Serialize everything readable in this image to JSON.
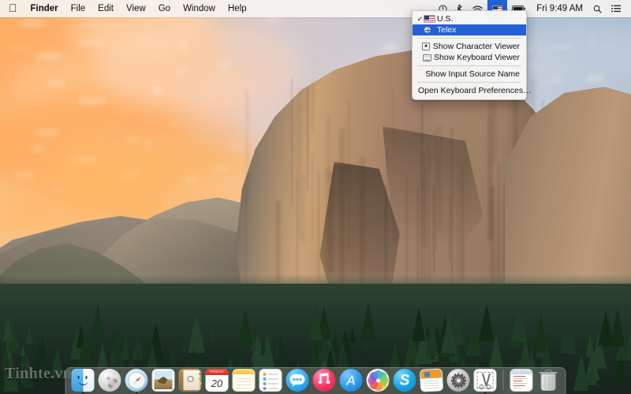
{
  "menubar": {
    "apple_icon": "apple-logo",
    "left_items": [
      {
        "label": "Finder",
        "bold": true
      },
      {
        "label": "File",
        "bold": false
      },
      {
        "label": "Edit",
        "bold": false
      },
      {
        "label": "View",
        "bold": false
      },
      {
        "label": "Go",
        "bold": false
      },
      {
        "label": "Window",
        "bold": false
      },
      {
        "label": "Help",
        "bold": false
      }
    ],
    "status_icons": [
      {
        "name": "control-center-icon",
        "glyph": "ⓘ"
      },
      {
        "name": "bluetooth-icon",
        "glyph": "ᛗ"
      },
      {
        "name": "wifi-icon",
        "glyph": "wifi"
      },
      {
        "name": "input-source-flag-icon",
        "glyph": "us-flag",
        "selected": true
      },
      {
        "name": "battery-icon",
        "glyph": "battery"
      }
    ],
    "clock": "Fri 9:49 AM",
    "search_icon": "search-icon",
    "notification_center_icon": "notification-center-icon"
  },
  "input_menu": {
    "items": [
      {
        "type": "source",
        "label": "U.S.",
        "icon": "us-flag-icon",
        "checked": true,
        "highlighted": false
      },
      {
        "type": "source",
        "label": "Telex",
        "icon": "telex-globe-icon",
        "checked": false,
        "highlighted": true
      },
      {
        "type": "separator"
      },
      {
        "type": "action",
        "label": "Show Character Viewer",
        "icon": "character-viewer-icon"
      },
      {
        "type": "action",
        "label": "Show Keyboard Viewer",
        "icon": "keyboard-viewer-icon"
      },
      {
        "type": "separator"
      },
      {
        "type": "action",
        "label": "Show Input Source Name",
        "icon": ""
      },
      {
        "type": "separator"
      },
      {
        "type": "action",
        "label": "Open Keyboard Preferences…",
        "icon": ""
      }
    ],
    "highlight_color": "#2560d6"
  },
  "dock": {
    "items": [
      {
        "name": "finder",
        "label": "Finder",
        "running": true
      },
      {
        "name": "launchpad",
        "label": "Launchpad",
        "running": false
      },
      {
        "name": "safari",
        "label": "Safari",
        "running": true
      },
      {
        "name": "photos-classic",
        "label": "iPhoto",
        "running": false
      },
      {
        "name": "contacts",
        "label": "Contacts",
        "running": false
      },
      {
        "name": "calendar",
        "label": "Calendar",
        "running": false,
        "day": "20",
        "month": "FRIDAY"
      },
      {
        "name": "notes",
        "label": "Notes",
        "running": false
      },
      {
        "name": "reminders",
        "label": "Reminders",
        "running": false
      },
      {
        "name": "messages",
        "label": "Messages",
        "running": false
      },
      {
        "name": "itunes",
        "label": "iTunes",
        "running": false
      },
      {
        "name": "app-store",
        "label": "App Store",
        "running": false,
        "glyph": "A"
      },
      {
        "name": "photos",
        "label": "Photos",
        "running": false
      },
      {
        "name": "skype",
        "label": "Skype",
        "running": false,
        "glyph": "S"
      },
      {
        "name": "keynote",
        "label": "Keynote",
        "running": false
      },
      {
        "name": "system-preferences",
        "label": "System Preferences",
        "running": false
      },
      {
        "name": "grab",
        "label": "Grab",
        "running": true
      },
      {
        "type": "separator"
      },
      {
        "name": "downloads-stack",
        "label": "Downloads",
        "running": false
      },
      {
        "name": "trash",
        "label": "Trash",
        "running": false
      }
    ]
  },
  "desktop": {
    "wallpaper_name": "El Capitan",
    "watermark": "Tinhte.vn"
  }
}
